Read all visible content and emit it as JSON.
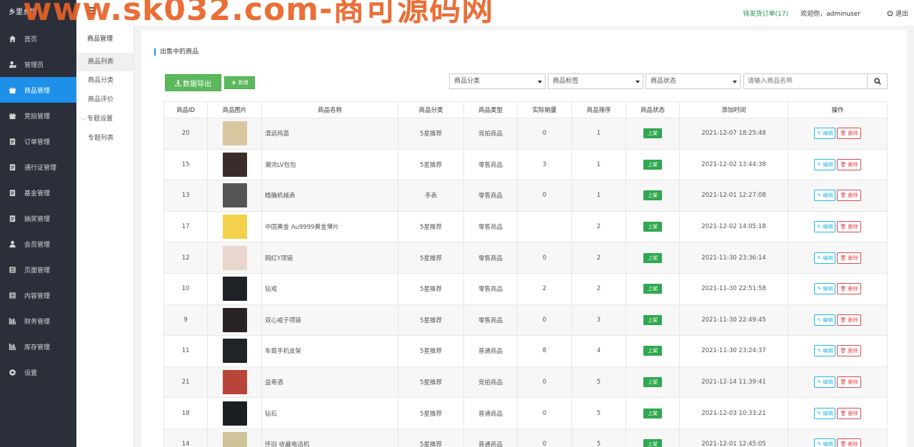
{
  "watermark": "www.sk032.com-商可源码网",
  "brand": "乡里乡情",
  "sidebar": {
    "items": [
      {
        "label": "首页",
        "icon": "home-icon",
        "active": false
      },
      {
        "label": "管理员",
        "icon": "admin-icon",
        "active": false
      },
      {
        "label": "商品管理",
        "icon": "gift-icon",
        "active": true
      },
      {
        "label": "竞拍管理",
        "icon": "gift-icon",
        "active": false
      },
      {
        "label": "订单管理",
        "icon": "clipboard-icon",
        "active": false
      },
      {
        "label": "通行证管理",
        "icon": "clipboard-icon",
        "active": false
      },
      {
        "label": "基金管理",
        "icon": "clipboard-icon",
        "active": false
      },
      {
        "label": "抽奖管理",
        "icon": "clipboard-icon",
        "active": false
      },
      {
        "label": "会员管理",
        "icon": "user-icon",
        "active": false
      },
      {
        "label": "页面管理",
        "icon": "page-icon",
        "active": false
      },
      {
        "label": "内容管理",
        "icon": "page-icon",
        "active": false
      },
      {
        "label": "财务管理",
        "icon": "bank-icon",
        "active": false
      },
      {
        "label": "库存管理",
        "icon": "bank-icon",
        "active": false
      },
      {
        "label": "设置",
        "icon": "gear-icon",
        "active": false
      }
    ]
  },
  "submenu": {
    "title": "商品管理",
    "items": [
      {
        "label": "商品列表",
        "active": true
      },
      {
        "label": "商品分类",
        "active": false
      },
      {
        "label": "商品评价",
        "active": false
      },
      {
        "label": "专题设置",
        "active": false,
        "group": true
      },
      {
        "label": "专题列表",
        "active": false
      }
    ]
  },
  "topbar": {
    "pending_label": "待发货订单",
    "pending_count": "(17)",
    "welcome": "欢迎你，adminuser",
    "logout": "退出"
  },
  "main": {
    "panel_title": "出售中的商品",
    "export_label": "数据导出",
    "add_label": "新增",
    "filters": {
      "category": "商品分类",
      "tag": "商品标签",
      "status": "商品状态",
      "search_placeholder": "请输入商品名称"
    },
    "table": {
      "columns": [
        "商品ID",
        "商品图片",
        "商品名称",
        "商品分类",
        "商品类型",
        "实际销量",
        "商品排序",
        "商品状态",
        "添加时间",
        "操作"
      ],
      "edit_label": "编辑",
      "delete_label": "删除",
      "rows": [
        {
          "id": "20",
          "name": "清远鸡苗",
          "category": "5星推荐",
          "type": "竞拍商品",
          "sales": "0",
          "sort": "1",
          "status": "上架",
          "time": "2021-12-07 18:25:48",
          "thumb": "#d8c7a0"
        },
        {
          "id": "15",
          "name": "潮流LV包包",
          "category": "5星推荐",
          "type": "零售商品",
          "sales": "3",
          "sort": "1",
          "status": "上架",
          "time": "2021-12-02 13:44:38",
          "thumb": "#3a2c28"
        },
        {
          "id": "13",
          "name": "精确机械表",
          "category": "手表",
          "type": "零售商品",
          "sales": "0",
          "sort": "1",
          "status": "上架",
          "time": "2021-12-01 12:27:08",
          "thumb": "#555555"
        },
        {
          "id": "17",
          "name": "中国黄金 Au9999黄金薄片",
          "category": "5星推荐",
          "type": "零售商品",
          "sales": "",
          "sort": "2",
          "status": "上架",
          "time": "2021-12-02 14:05:18",
          "thumb": "#f3d14a"
        },
        {
          "id": "12",
          "name": "网红Y项链",
          "category": "5星推荐",
          "type": "零售商品",
          "sales": "0",
          "sort": "2",
          "status": "上架",
          "time": "2021-11-30 23:36:14",
          "thumb": "#e9d6cc"
        },
        {
          "id": "10",
          "name": "钻戒",
          "category": "5星推荐",
          "type": "零售商品",
          "sales": "2",
          "sort": "2",
          "status": "上架",
          "time": "2021-11-30 22:51:58",
          "thumb": "#1e2226"
        },
        {
          "id": "9",
          "name": "双心戒子项链",
          "category": "5星推荐",
          "type": "零售商品",
          "sales": "0",
          "sort": "3",
          "status": "上架",
          "time": "2021-11-30 22:49:45",
          "thumb": "#2a2326"
        },
        {
          "id": "11",
          "name": "车载手机支架",
          "category": "5星推荐",
          "type": "普通商品",
          "sales": "8",
          "sort": "4",
          "status": "上架",
          "time": "2021-11-30 23:24:37",
          "thumb": "#202428"
        },
        {
          "id": "21",
          "name": "益寿酒",
          "category": "5星推荐",
          "type": "竞拍商品",
          "sales": "0",
          "sort": "5",
          "status": "上架",
          "time": "2021-12-14 11:39:41",
          "thumb": "#b8453a"
        },
        {
          "id": "18",
          "name": "钻石",
          "category": "5星推荐",
          "type": "普通商品",
          "sales": "0",
          "sort": "5",
          "status": "上架",
          "time": "2021-12-03 10:33:21",
          "thumb": "#1c1f22"
        },
        {
          "id": "14",
          "name": "怀旧 收藏电话机",
          "category": "5星推荐",
          "type": "普通商品",
          "sales": "0",
          "sort": "5",
          "status": "上架",
          "time": "2021-12-01 12:45:05",
          "thumb": "#cfc39a"
        }
      ]
    }
  }
}
